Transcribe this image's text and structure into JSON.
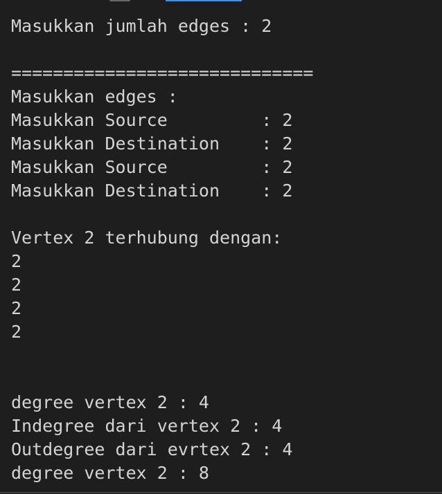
{
  "terminal": {
    "lines": [
      "Masukkan jumlah edges : 2",
      "",
      "=============================",
      "Masukkan edges :",
      "Masukkan Source         : 2",
      "Masukkan Destination    : 2",
      "Masukkan Source         : 2",
      "Masukkan Destination    : 2",
      "",
      "Vertex 2 terhubung dengan:",
      "2",
      "2",
      "2",
      "2",
      "",
      "",
      "degree vertex 2 : 4",
      "Indegree dari vertex 2 : 4",
      "Outdegree dari evrtex 2 : 4",
      "degree vertex 2 : 8"
    ]
  },
  "colors": {
    "background": "#1e1e1e",
    "text": "#d4d4d4",
    "active_tab_indicator": "#3794ff"
  }
}
